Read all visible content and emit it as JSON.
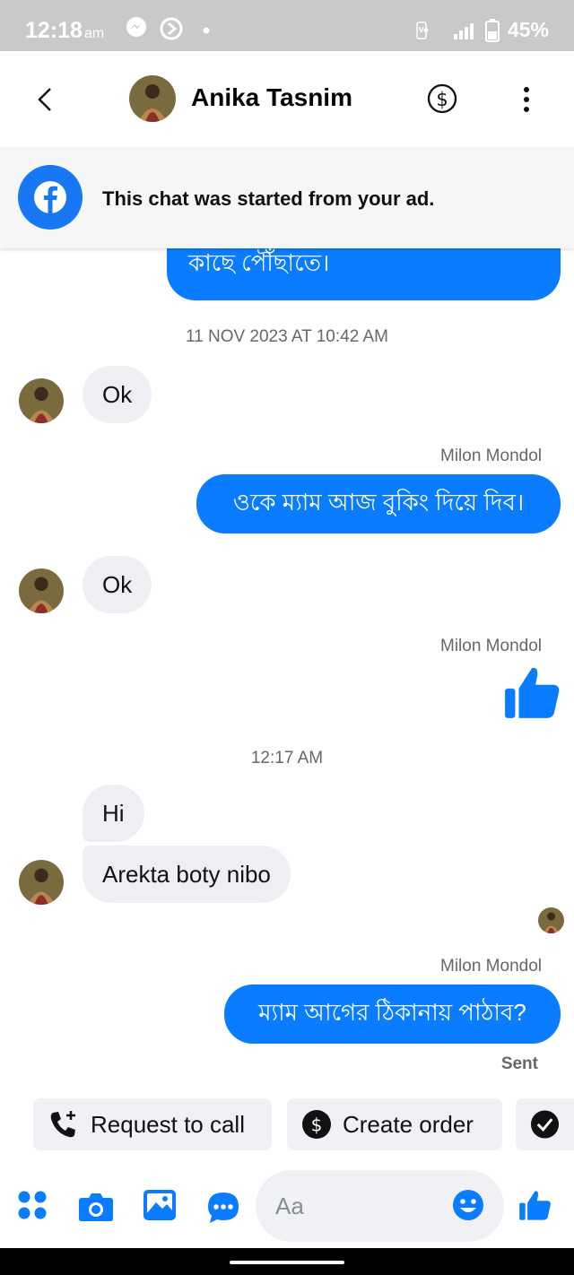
{
  "status_bar": {
    "time": "12:18",
    "ampm": "am",
    "battery": "45%"
  },
  "header": {
    "contact_name": "Anika Tasnim"
  },
  "ad_banner": {
    "text": "This chat was started from your ad."
  },
  "messages": {
    "partial_out": "কাছে পৌঁছাতে।",
    "timestamp_1": "11 NOV 2023 AT 10:42 AM",
    "in_1": "Ok",
    "sender_1": "Milon Mondol",
    "out_1": "ওকে ম্যাম আজ বুকিং দিয়ে দিব।",
    "in_2": "Ok",
    "sender_2": "Milon Mondol",
    "timestamp_2": "12:17 AM",
    "in_3": "Hi",
    "in_4": "Arekta boty nibo",
    "sender_3": "Milon Mondol",
    "out_2": "ম্যাম আগের ঠিকানায় পাঠাব?",
    "sent_status": "Sent"
  },
  "quick_actions": {
    "request_call": "Request to call",
    "create_order": "Create order"
  },
  "composer": {
    "placeholder": "Aa"
  },
  "colors": {
    "accent": "#0a7cff",
    "incoming_bubble": "#eeeff2",
    "status_bar": "#c9c9cc"
  }
}
